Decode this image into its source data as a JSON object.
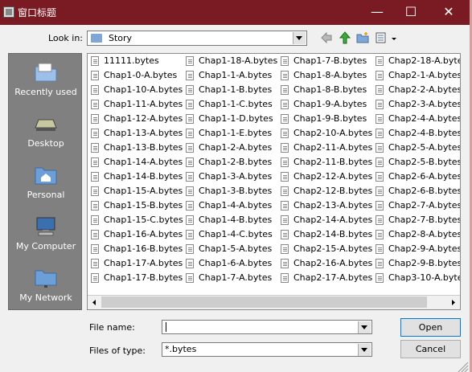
{
  "window": {
    "title": "窗口标题"
  },
  "title_buttons": {
    "minimize": "—",
    "maximize": "☐",
    "close": "✕"
  },
  "look_in": {
    "label": "Look in:",
    "value": "Story"
  },
  "places": [
    {
      "label": "Recently used",
      "icon": "recent-folder-icon"
    },
    {
      "label": "Desktop",
      "icon": "desktop-icon"
    },
    {
      "label": "Personal",
      "icon": "home-folder-icon"
    },
    {
      "label": "My Computer",
      "icon": "computer-icon"
    },
    {
      "label": "My Network",
      "icon": "network-icon"
    }
  ],
  "files": [
    [
      "11111.bytes",
      "Chap1-0-A.bytes",
      "Chap1-10-A.bytes",
      "Chap1-11-A.bytes",
      "Chap1-12-A.bytes",
      "Chap1-13-A.bytes",
      "Chap1-13-B.bytes",
      "Chap1-14-A.bytes",
      "Chap1-14-B.bytes",
      "Chap1-15-A.bytes",
      "Chap1-15-B.bytes",
      "Chap1-15-C.bytes",
      "Chap1-16-A.bytes",
      "Chap1-16-B.bytes",
      "Chap1-17-A.bytes",
      "Chap1-17-B.bytes"
    ],
    [
      "Chap1-18-A.bytes",
      "Chap1-1-A.bytes",
      "Chap1-1-B.bytes",
      "Chap1-1-C.bytes",
      "Chap1-1-D.bytes",
      "Chap1-1-E.bytes",
      "Chap1-2-A.bytes",
      "Chap1-2-B.bytes",
      "Chap1-3-A.bytes",
      "Chap1-3-B.bytes",
      "Chap1-4-A.bytes",
      "Chap1-4-B.bytes",
      "Chap1-4-C.bytes",
      "Chap1-5-A.bytes",
      "Chap1-6-A.bytes",
      "Chap1-7-A.bytes"
    ],
    [
      "Chap1-7-B.bytes",
      "Chap1-8-A.bytes",
      "Chap1-8-B.bytes",
      "Chap1-9-A.bytes",
      "Chap1-9-B.bytes",
      "Chap2-10-A.bytes",
      "Chap2-11-A.bytes",
      "Chap2-11-B.bytes",
      "Chap2-12-A.bytes",
      "Chap2-12-B.bytes",
      "Chap2-13-A.bytes",
      "Chap2-14-A.bytes",
      "Chap2-14-B.bytes",
      "Chap2-15-A.bytes",
      "Chap2-16-A.bytes",
      "Chap2-17-A.bytes"
    ],
    [
      "Chap2-18-A.bytes",
      "Chap2-1-A.bytes",
      "Chap2-2-A.bytes",
      "Chap2-3-A.bytes",
      "Chap2-4-A.bytes",
      "Chap2-4-B.bytes",
      "Chap2-5-A.bytes",
      "Chap2-5-B.bytes",
      "Chap2-6-A.bytes",
      "Chap2-6-B.bytes",
      "Chap2-7-A.bytes",
      "Chap2-7-B.bytes",
      "Chap2-8-A.bytes",
      "Chap2-9-A.bytes",
      "Chap2-9-B.bytes",
      "Chap3-10-A.bytes"
    ]
  ],
  "file_name": {
    "label": "File name:",
    "value": ""
  },
  "file_type": {
    "label": "Files of type:",
    "value": "*.bytes"
  },
  "buttons": {
    "open": "Open",
    "cancel": "Cancel"
  },
  "colors": {
    "titlebar": "#7a1a22",
    "sidebar": "#808080"
  }
}
